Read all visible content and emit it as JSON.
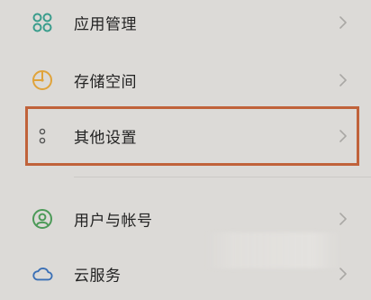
{
  "menu": {
    "items": [
      {
        "label": "应用管理",
        "icon": "apps-grid-icon"
      },
      {
        "label": "存储空间",
        "icon": "storage-pie-icon"
      },
      {
        "label": "其他设置",
        "icon": "more-dots-icon"
      },
      {
        "label": "用户与帐号",
        "icon": "user-account-icon"
      },
      {
        "label": "云服务",
        "icon": "cloud-icon"
      }
    ]
  },
  "colors": {
    "background": "#dcdad7",
    "apps_icon": "#3a9d8c",
    "storage_icon": "#e0a33a",
    "user_icon": "#4c9a58",
    "cloud_icon": "#3a6fb5",
    "highlight": "#c0623a",
    "chevron": "#a9a7a4"
  }
}
